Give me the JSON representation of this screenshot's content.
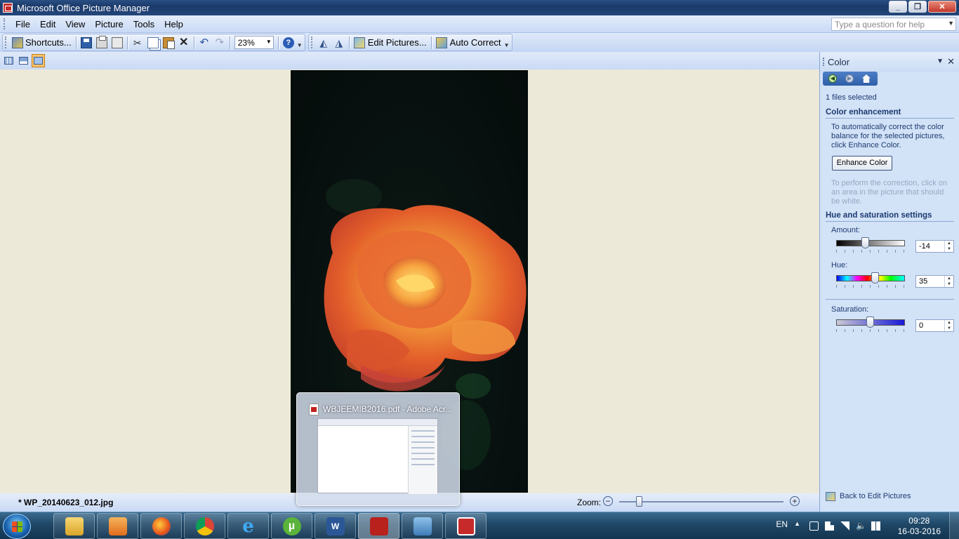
{
  "window": {
    "title": "Microsoft Office Picture Manager",
    "buttons": [
      "_",
      "❐",
      "✕"
    ]
  },
  "menu": {
    "items": [
      "File",
      "Edit",
      "View",
      "Picture",
      "Tools",
      "Help"
    ],
    "help_placeholder": "Type a question for help"
  },
  "toolbar": {
    "shortcuts_label": "Shortcuts...",
    "zoom_value": "23%",
    "edit_pictures_label": "Edit Pictures...",
    "auto_correct_label": "Auto Correct"
  },
  "status": {
    "filename": "* WP_20140623_012.jpg",
    "zoom_label": "Zoom:",
    "zoom_position": 0.12
  },
  "preview": {
    "title": "WBJEEMIB2016.pdf - Adobe Acr..."
  },
  "taskpane": {
    "title": "Color",
    "files_selected": "1 files selected",
    "color_enhancement_heading": "Color enhancement",
    "color_enhancement_text": "To automatically correct the color balance for the selected pictures, click Enhance Color.",
    "enhance_button": "Enhance Color",
    "correction_hint": "To perform the correction, click on an area in the picture that should be white.",
    "hue_sat_heading": "Hue and saturation settings",
    "amount_label": "Amount:",
    "amount_value": "-14",
    "amount_level": 0.43,
    "hue_label": "Hue:",
    "hue_value": "35",
    "hue_level": 0.57,
    "saturation_label": "Saturation:",
    "saturation_value": "0",
    "saturation_level": 0.5,
    "back_link": "Back to Edit Pictures"
  },
  "taskbar": {
    "apps": [
      "Windows Explorer",
      "Media Player",
      "Firefox",
      "Chrome",
      "Internet Explorer",
      "uTorrent",
      "Word",
      "Adobe Acrobat",
      "Picture Viewer",
      "Picture Manager"
    ],
    "language": "EN",
    "time": "09:28",
    "date": "16-03-2016"
  },
  "colors": {
    "menu_bg": "#d6e3f7",
    "pane_bg": "#d2e2f7",
    "canvas_bg": "#ece9d8",
    "heading_color": "#1d3a70"
  }
}
